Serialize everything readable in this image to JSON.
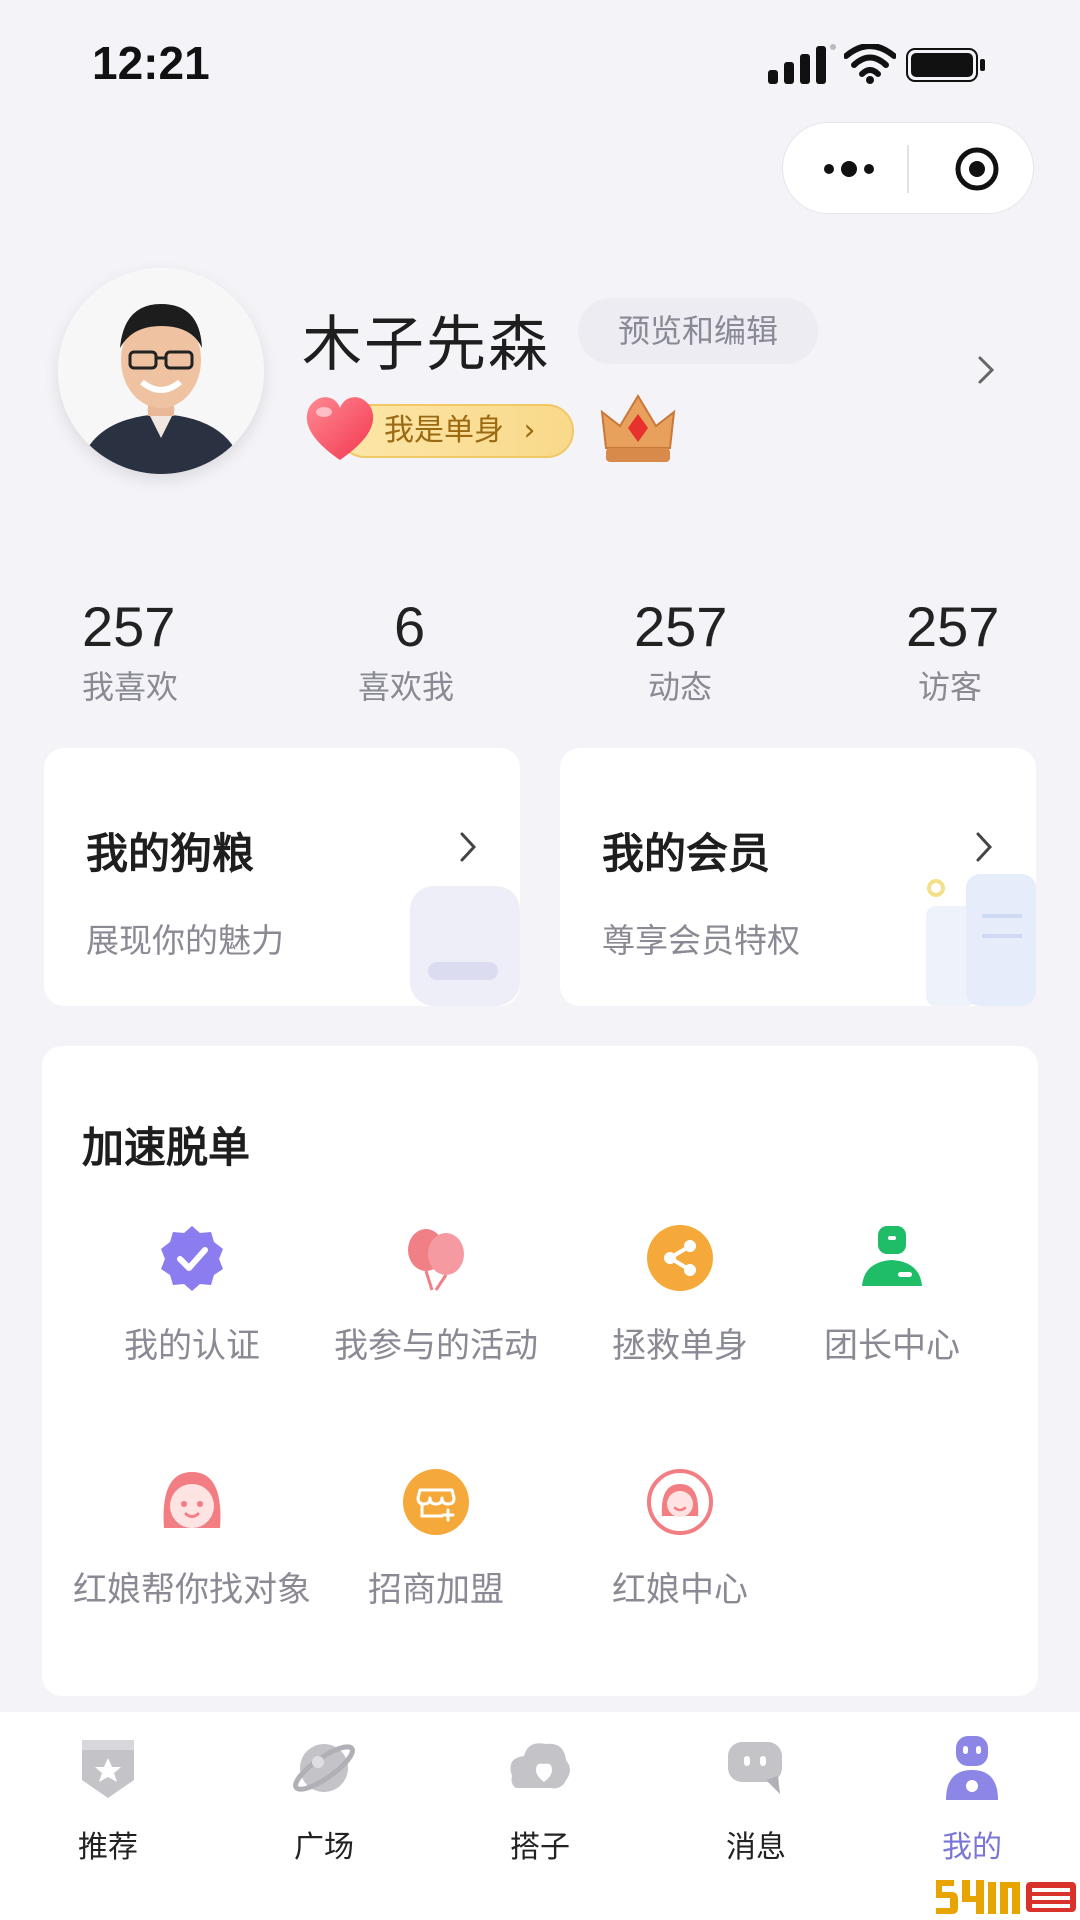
{
  "status_bar": {
    "time": "12:21"
  },
  "profile": {
    "name": "木子先森",
    "edit_label": "预览和编辑",
    "single_badge": "我是单身"
  },
  "stats": [
    {
      "value": "257",
      "label": "我喜欢"
    },
    {
      "value": "6",
      "label": "喜欢我"
    },
    {
      "value": "257",
      "label": "动态"
    },
    {
      "value": "257",
      "label": "访客"
    }
  ],
  "cards": [
    {
      "title": "我的狗粮",
      "subtitle": "展现你的魅力"
    },
    {
      "title": "我的会员",
      "subtitle": "尊享会员特权"
    }
  ],
  "section": {
    "title": "加速脱单",
    "features": [
      {
        "label": "我的认证",
        "icon": "verified-badge-icon",
        "color": "#8b7cf0"
      },
      {
        "label": "我参与的活动",
        "icon": "balloons-icon",
        "color": "#f07f86"
      },
      {
        "label": "拯救单身",
        "icon": "share-icon",
        "color": "#f6a93b"
      },
      {
        "label": "团长中心",
        "icon": "leader-icon",
        "color": "#1fbd68"
      },
      {
        "label": "红娘帮你找对象",
        "icon": "girl-face-icon",
        "color": "#f27e84"
      },
      {
        "label": "招商加盟",
        "icon": "store-icon",
        "color": "#f6a93b"
      },
      {
        "label": "红娘中心",
        "icon": "matchmaker-icon",
        "color": "#f27e84"
      }
    ]
  },
  "tabs": [
    {
      "label": "推荐",
      "icon": "recommend-icon",
      "active": false
    },
    {
      "label": "广场",
      "icon": "planet-icon",
      "active": false
    },
    {
      "label": "搭子",
      "icon": "buddy-icon",
      "active": false
    },
    {
      "label": "消息",
      "icon": "message-icon",
      "active": false
    },
    {
      "label": "我的",
      "icon": "me-icon",
      "active": true
    }
  ],
  "colors": {
    "accent": "#7a76d8",
    "background": "#f4f4f8",
    "badge": "#f9d98a"
  }
}
